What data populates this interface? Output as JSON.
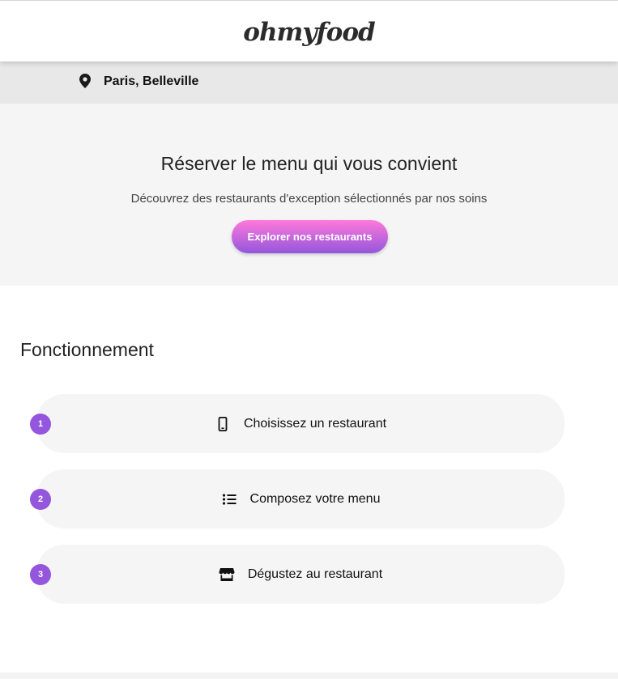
{
  "header": {
    "logo_text": "ohmyfood"
  },
  "location": {
    "icon": "map-pin-icon",
    "text": "Paris, Belleville"
  },
  "hero": {
    "title": "Réserver le menu qui vous convient",
    "subtitle": "Découvrez des restaurants d'exception sélectionnés par nos soins",
    "cta_label": "Explorer nos restaurants"
  },
  "how_it_works": {
    "title": "Fonctionnement",
    "steps": [
      {
        "number": "1",
        "icon": "mobile-phone-icon",
        "label": "Choisissez un restaurant"
      },
      {
        "number": "2",
        "icon": "list-icon",
        "label": "Composez votre menu"
      },
      {
        "number": "3",
        "icon": "store-icon",
        "label": "Dégustez au restaurant"
      }
    ]
  },
  "colors": {
    "accent_purple": "#9356dc",
    "accent_pink": "#ff79da",
    "hero_background": "#f5f5f5",
    "location_background": "#e8e8e8"
  }
}
